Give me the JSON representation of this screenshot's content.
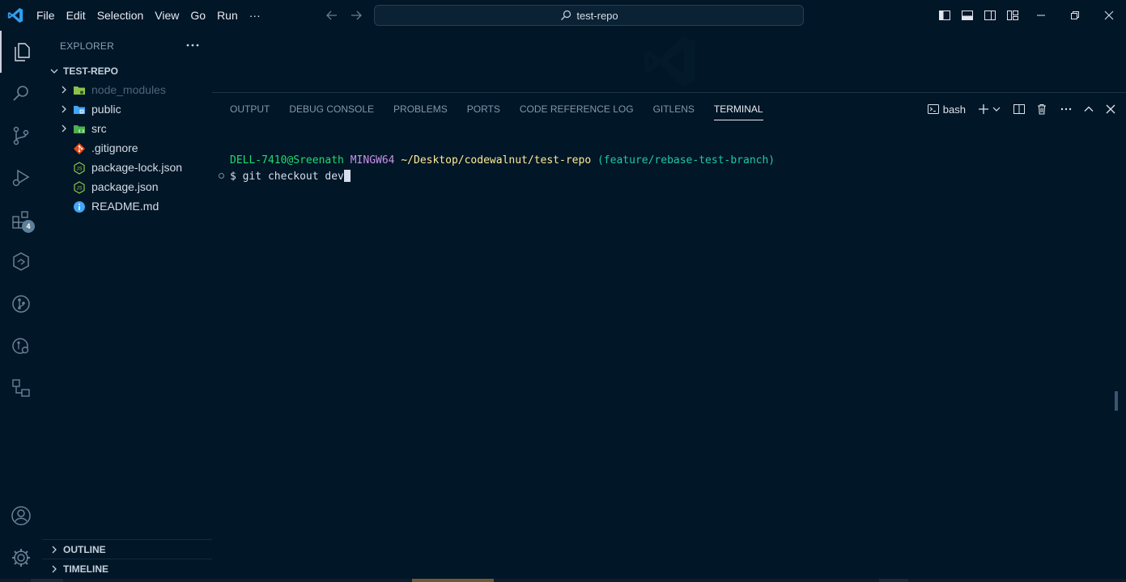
{
  "menu": [
    "File",
    "Edit",
    "Selection",
    "View",
    "Go",
    "Run",
    "···"
  ],
  "command_center": {
    "label": "test-repo",
    "icon": "search-icon"
  },
  "sidebar": {
    "header": "EXPLORER",
    "root": "TEST-REPO",
    "items": [
      {
        "name": "node_modules",
        "type": "folder",
        "icon": "folder-node-icon",
        "color": "#8bc34a",
        "dim": true
      },
      {
        "name": "public",
        "type": "folder",
        "icon": "folder-public-icon",
        "color": "#42a5f5"
      },
      {
        "name": "src",
        "type": "folder",
        "icon": "folder-src-icon",
        "color": "#4caf50"
      },
      {
        "name": ".gitignore",
        "type": "file",
        "icon": "git-icon",
        "color": "#e64a19"
      },
      {
        "name": "package-lock.json",
        "type": "file",
        "icon": "nodejs-icon",
        "color": "#8bc34a"
      },
      {
        "name": "package.json",
        "type": "file",
        "icon": "nodejs-icon",
        "color": "#8bc34a"
      },
      {
        "name": "README.md",
        "type": "file",
        "icon": "info-icon",
        "color": "#42a5f5"
      }
    ],
    "outline": "OUTLINE",
    "timeline": "TIMELINE"
  },
  "activity": {
    "extensions_badge": "4"
  },
  "panel": {
    "tabs": [
      "OUTPUT",
      "DEBUG CONSOLE",
      "PROBLEMS",
      "PORTS",
      "CODE REFERENCE LOG",
      "GITLENS",
      "TERMINAL"
    ],
    "active_tab": "TERMINAL",
    "shell": "bash"
  },
  "terminal": {
    "user": "DELL-7410@Sreenath",
    "host": "MINGW64",
    "path": "~/Desktop/codewalnut/test-repo",
    "branch": "(feature/rebase-test-branch)",
    "prompt": "$ git checkout dev"
  }
}
